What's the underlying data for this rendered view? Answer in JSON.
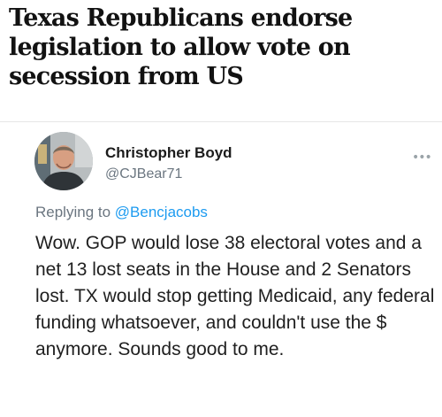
{
  "article": {
    "headline": "Texas Republicans endorse legislation to allow vote on secession from US"
  },
  "tweet": {
    "author": {
      "name": "Christopher Boyd",
      "handle": "@CJBear71"
    },
    "more_icon": "more-horizontal-icon",
    "reply_prefix": "Replying to ",
    "reply_to": "@Bencjacobs",
    "text": "Wow. GOP would lose 38 electoral votes and a net 13 lost seats in the House and 2 Senators lost. TX would stop getting Medicaid, any federal funding whatsoever, and couldn't use the $ anymore. Sounds good to me."
  },
  "colors": {
    "headline": "#121212",
    "secondary_text": "#6b7680",
    "mention_link": "#1d9bf0"
  }
}
